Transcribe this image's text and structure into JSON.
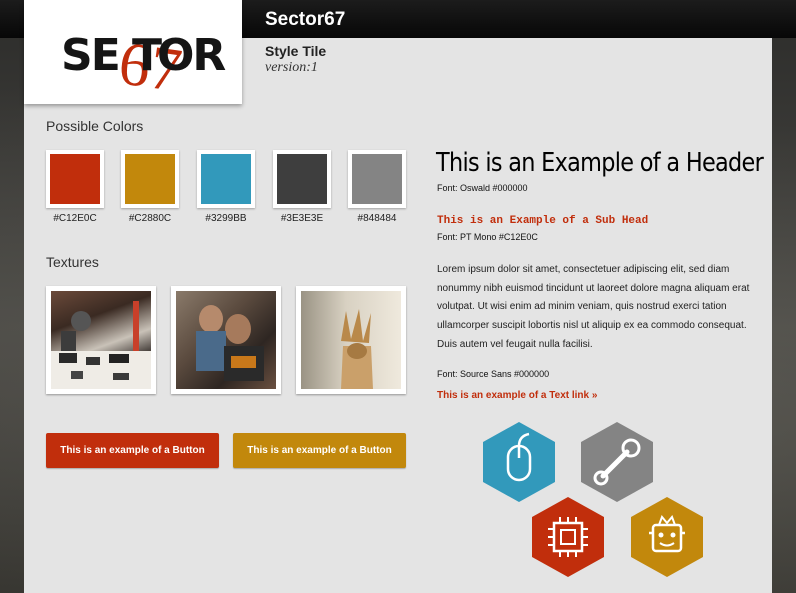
{
  "header": {
    "site_title": "Sector67"
  },
  "logo": {
    "text_left": "SE",
    "text_mid": "67",
    "text_right": "OR",
    "text_t": "T"
  },
  "tile": {
    "title": "Style Tile",
    "version": "version:1"
  },
  "colors_section": {
    "heading": "Possible Colors",
    "swatches": [
      {
        "hex": "#C12E0C",
        "label": "#C12E0C"
      },
      {
        "hex": "#C2880C",
        "label": "#C2880C"
      },
      {
        "hex": "#3299BB",
        "label": "#3299BB"
      },
      {
        "hex": "#3E3E3E",
        "label": "#3E3E3E"
      },
      {
        "hex": "#848484",
        "label": "#848484"
      }
    ]
  },
  "textures_section": {
    "heading": "Textures"
  },
  "buttons": {
    "primary_label": "This is an example of a Button",
    "secondary_label": "This is an example of a Button",
    "primary_color": "#C12E0C",
    "secondary_color": "#C2880C"
  },
  "typography": {
    "header_example": "This is an Example of a Header",
    "header_font": "Font: Oswald #000000",
    "subhead_example": "This is an Example of a Sub Head",
    "subhead_font": "Font: PT Mono #C12E0C",
    "body_text": "Lorem ipsum dolor sit amet, consectetuer adipiscing elit, sed diam nonummy nibh euismod tincidunt ut laoreet dolore magna aliquam erat volutpat. Ut wisi enim ad minim veniam, quis nostrud exerci tation ullamcorper suscipit lobortis nisl ut aliquip ex ea commodo consequat. Duis autem vel feugait nulla facilisi.",
    "body_font": "Font: Source Sans #000000",
    "text_link": "This is an example of a Text link »"
  },
  "icons": [
    {
      "name": "mouse-icon",
      "color": "#3299BB"
    },
    {
      "name": "wrench-icon",
      "color": "#848484"
    },
    {
      "name": "chip-icon",
      "color": "#C12E0C"
    },
    {
      "name": "robot-icon",
      "color": "#C2880C"
    }
  ]
}
